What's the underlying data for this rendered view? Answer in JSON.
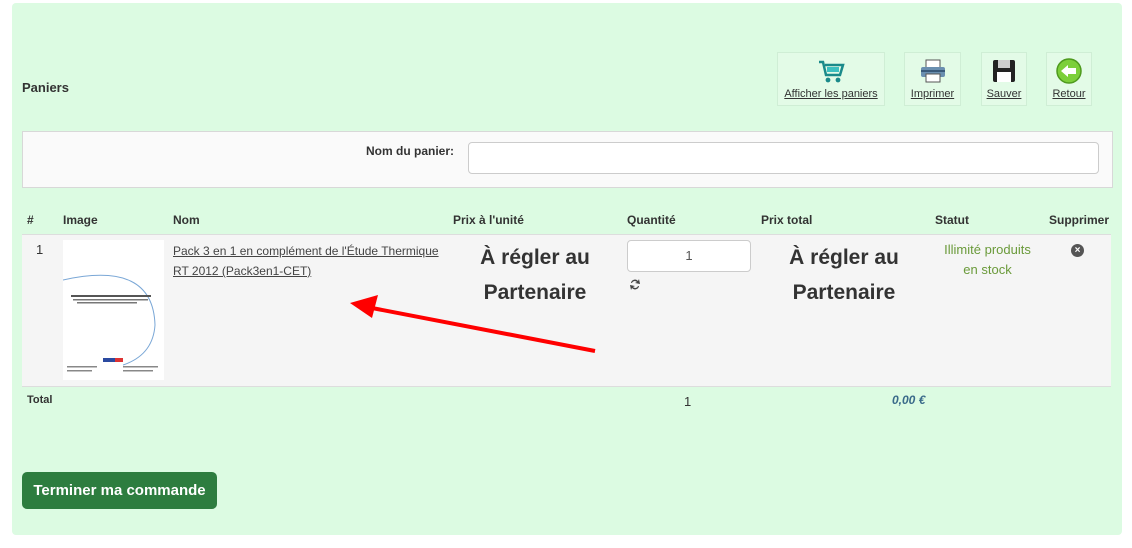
{
  "header": {
    "title": "Paniers"
  },
  "toolbar": {
    "show_carts": "Afficher les paniers",
    "print": "Imprimer",
    "save": "Sauver",
    "back": "Retour"
  },
  "form": {
    "cart_name_label": "Nom du panier:",
    "cart_name_value": ""
  },
  "table": {
    "headers": [
      "#",
      "Image",
      "Nom",
      "Prix à l'unité",
      "Quantité",
      "Prix total",
      "Statut",
      "Supprimer"
    ],
    "rows": [
      {
        "index": "1",
        "name": "Pack 3 en 1 en complément de l'Étude Thermique RT 2012 (Pack3en1-CET)",
        "unit_price_line1": "À régler au",
        "unit_price_line2": "Partenaire",
        "quantity": "1",
        "total_price_line1": "À régler au",
        "total_price_line2": "Partenaire",
        "status_line1": "Illimité produits",
        "status_line2": "en stock"
      }
    ],
    "total_label": "Total",
    "total_quantity": "1",
    "total_price": "0,00 €"
  },
  "actions": {
    "finish_order": "Terminer ma commande"
  },
  "colors": {
    "panel_bg": "#dcfbe2",
    "button_bg": "#2d7d3f",
    "status_text": "#6a9a3a",
    "annotation_arrow": "#ff0000"
  }
}
